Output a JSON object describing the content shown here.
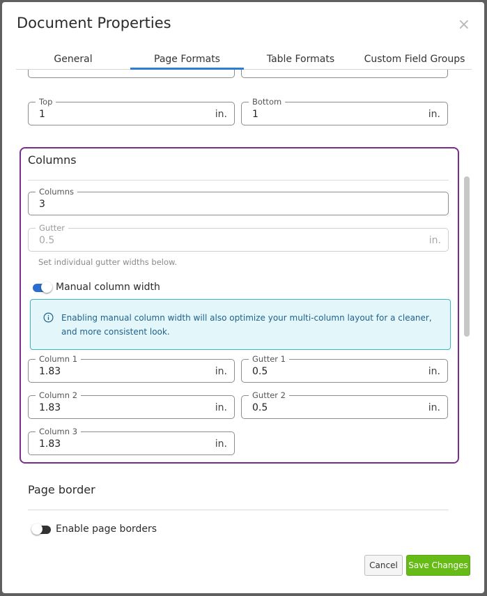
{
  "dialog": {
    "title": "Document Properties",
    "close_glyph": "×",
    "tabs": [
      "General",
      "Page Formats",
      "Table Formats",
      "Custom Field Groups"
    ],
    "active_tab": "Page Formats"
  },
  "margins": {
    "top": {
      "label": "Top",
      "value": "1",
      "unit": "in."
    },
    "bottom": {
      "label": "Bottom",
      "value": "1",
      "unit": "in."
    }
  },
  "columns_section": {
    "title": "Columns",
    "columns_field": {
      "label": "Columns",
      "value": "3"
    },
    "gutter_field": {
      "label": "Gutter",
      "value": "0.5",
      "unit": "in.",
      "disabled": true
    },
    "helper": "Set individual gutter widths below.",
    "manual_toggle": {
      "label": "Manual column width",
      "on": true
    },
    "info_text": "Enabling manual column width will also optimize your multi-column layout for a cleaner, and more consistent look.",
    "column_fields": [
      {
        "label": "Column 1",
        "value": "1.83",
        "unit": "in."
      },
      {
        "label": "Column 2",
        "value": "1.83",
        "unit": "in."
      },
      {
        "label": "Column 3",
        "value": "1.83",
        "unit": "in."
      }
    ],
    "gutter_fields": [
      {
        "label": "Gutter 1",
        "value": "0.5",
        "unit": "in."
      },
      {
        "label": "Gutter 2",
        "value": "0.5",
        "unit": "in."
      }
    ]
  },
  "page_border": {
    "title": "Page border",
    "toggle": {
      "label": "Enable page borders",
      "on": false
    }
  },
  "footer": {
    "cancel_label": "Cancel",
    "save_label": "Save Changes"
  },
  "colors": {
    "accent_tab": "#2a7ed6",
    "section_highlight": "#7b2d8e",
    "toggle_on": "#2a6fd0",
    "save_green": "#66bb16",
    "info_bg": "#e3f7fb"
  },
  "icons": {
    "info": "info-circle-icon",
    "close": "close-icon"
  }
}
